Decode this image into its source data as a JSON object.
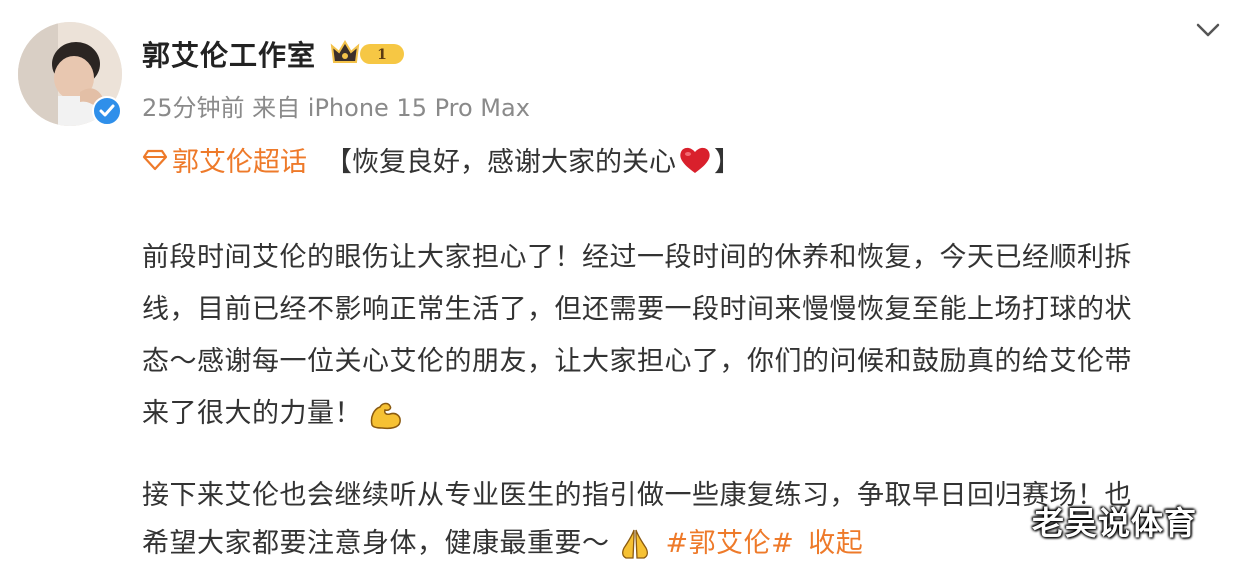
{
  "post": {
    "author": "郭艾伦工作室",
    "vip_level": "1",
    "meta": "25分钟前  来自 iPhone 15 Pro Max",
    "topic": "郭艾伦超话",
    "headline_open": "【恢复良好，感谢大家的关心",
    "headline_close": "】",
    "para1_lines": [
      "前段时间艾伦的眼伤让大家担心了！经过一段时间的休养和恢复，今天已经顺利拆",
      "线，目前已经不影响正常生活了，但还需要一段时间来慢慢恢复至能上场打球的状",
      "态～感谢每一位关心艾伦的朋友，让大家担心了，你们的问候和鼓励真的给艾伦带",
      "来了很大的力量！"
    ],
    "para2_lines": [
      "接下来艾伦也会继续听从专业医生的指引做一些康复练习，争取早日回归赛场！也",
      "希望大家都要注意身体，健康最重要～"
    ],
    "hashtag": "#郭艾伦#",
    "collapse": "收起"
  },
  "watermark": "老吴说体育",
  "icons": {
    "avatar": "user-avatar",
    "verified": "verified-badge-icon",
    "vip": "vip-crown-icon",
    "chevron": "chevron-down-icon",
    "topic": "supertopic-diamond-icon",
    "heart": "red-heart-emoji",
    "muscle": "flexed-biceps-emoji",
    "pray": "folded-hands-emoji"
  },
  "colors": {
    "accent": "#ee7a2a",
    "verified": "#2f8fea",
    "text": "#333333",
    "meta": "#8a8a8a"
  }
}
